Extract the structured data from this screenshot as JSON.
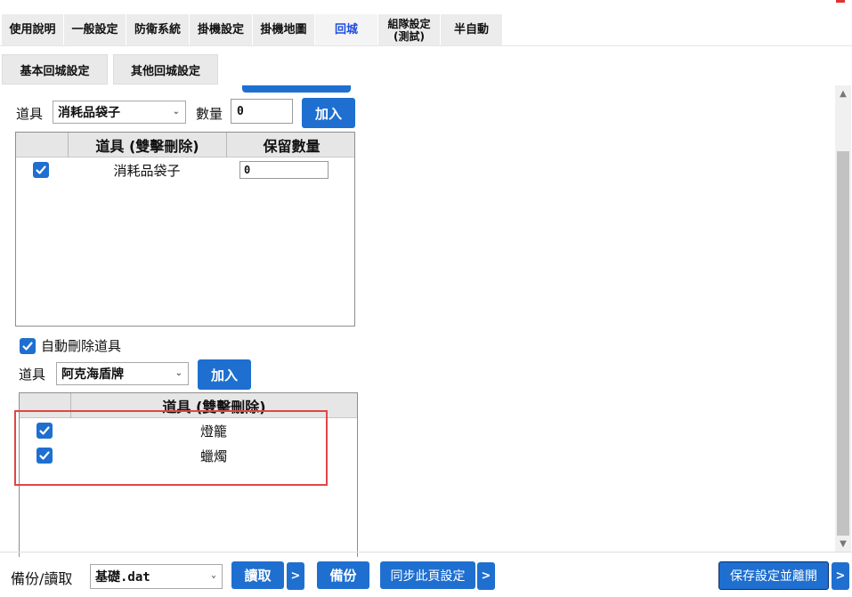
{
  "top_tabs": [
    {
      "label": "使用說明"
    },
    {
      "label": "一般設定"
    },
    {
      "label": "防衛系統"
    },
    {
      "label": "掛機設定"
    },
    {
      "label": "掛機地圖"
    },
    {
      "label": "回城"
    },
    {
      "label": "組隊設定\n(測試)"
    },
    {
      "label": "半自動"
    }
  ],
  "active_tab": "回城",
  "sub_tabs": [
    {
      "label": "基本回城設定"
    },
    {
      "label": "其他回城設定"
    }
  ],
  "delete_section": {
    "item_label": "道具",
    "item_value": "消耗品袋子",
    "qty_label": "數量",
    "qty_value": "0",
    "add_button": "加入",
    "columns": [
      "道具 (雙擊刪除)",
      "保留數量"
    ],
    "rows": [
      {
        "checked": true,
        "item": "消耗品袋子",
        "qty": "0"
      }
    ]
  },
  "auto_delete": {
    "checkbox_label": "自動刪除道具",
    "checked": true,
    "item_label": "道具",
    "item_value": "阿克海盾牌",
    "add_button": "加入",
    "column": "道具 (雙擊刪除)",
    "rows": [
      {
        "checked": true,
        "item": "燈籠"
      },
      {
        "checked": true,
        "item": "蠟燭"
      }
    ]
  },
  "bottom_bar": {
    "label": "備份/讀取",
    "file_value": "基礎.dat",
    "read_button": "讀取",
    "more_arrow": ">",
    "backup_button": "備份",
    "sync_button": "同步此頁設定",
    "save_exit_button": "保存設定並離開"
  },
  "colors": {
    "accent": "#1e6fd0",
    "active_tab_text": "#1e4de0",
    "highlight_border": "#e24545"
  }
}
